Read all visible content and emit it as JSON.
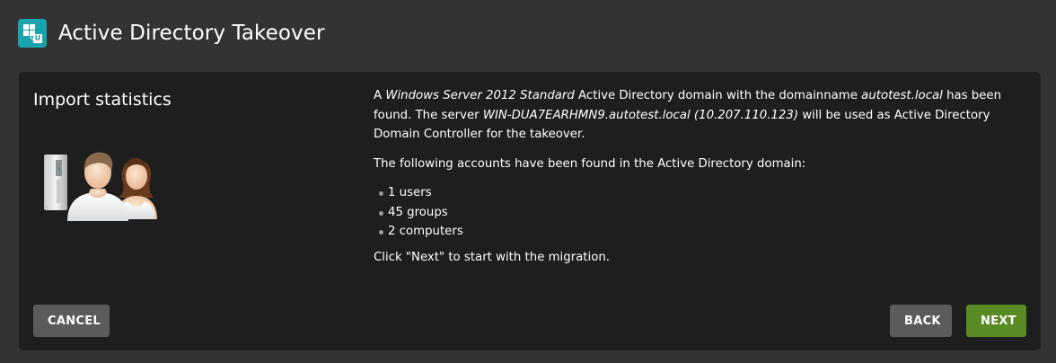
{
  "header": {
    "title": "Active Directory Takeover",
    "icon": "windows-univention-icon",
    "accent_color": "#1aa3ad"
  },
  "card": {
    "section_title": "Import statistics",
    "illustration": "server-users-illustration",
    "intro": {
      "t1": "A ",
      "os": "Windows Server 2012 Standard",
      "t2": " Active Directory domain with the domainname ",
      "domain": "autotest.local",
      "t3": " has been found. The server ",
      "server": "WIN-DUA7EARHMN9.autotest.local (10.207.110.123)",
      "t4": " will be used as Active Directory Domain Controller for the takeover."
    },
    "accounts_intro": "The following accounts have been found in the Active Directory domain:",
    "accounts": [
      "1 users",
      "45 groups",
      "2 computers"
    ],
    "outro": "Click \"Next\" to start with the migration."
  },
  "buttons": {
    "cancel": "CANCEL",
    "back": "BACK",
    "next": "NEXT",
    "next_color": "#5a8a24",
    "secondary_color": "#5b5b5b"
  }
}
